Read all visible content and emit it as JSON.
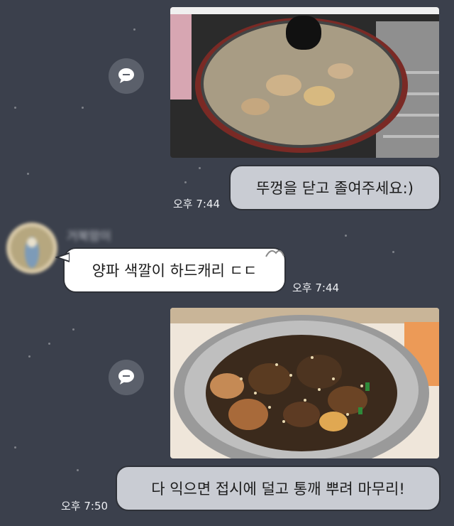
{
  "messages": [
    {
      "type": "image",
      "image_desc": "pot with lid on stove"
    },
    {
      "type": "text",
      "from": "me",
      "text": "뚜껑을 닫고 졸여주세요:)",
      "time": "오후 7:44"
    },
    {
      "type": "text",
      "from": "other",
      "sender": "거북맘이",
      "text": "양파 색깔이 하드캐리 ㄷㄷ",
      "time": "오후 7:44"
    },
    {
      "type": "image",
      "image_desc": "braised chicken in metal bowl"
    },
    {
      "type": "text",
      "from": "me",
      "text": "다 익으면 접시에 덜고 통깨 뿌려 마무리!",
      "time": "오후 7:50"
    }
  ],
  "icons": {
    "share": "speech-bubble-icon"
  },
  "colors": {
    "background": "#3b404c",
    "my_bubble": "#c9ccd3",
    "their_bubble": "#ffffff"
  }
}
